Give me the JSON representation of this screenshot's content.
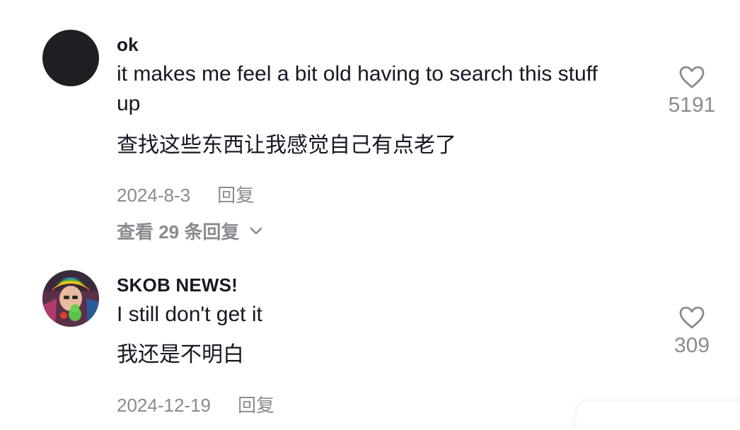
{
  "comments": [
    {
      "username": "ok",
      "text": "it makes me feel a bit old having to search this stuff up",
      "translation": "查找这些东西让我感觉自己有点老了",
      "date": "2024-8-3",
      "reply_label": "回复",
      "view_replies": "查看 29 条回复",
      "likes": "5191",
      "avatar": "dark-circle"
    },
    {
      "username": "SKOB NEWS!",
      "text": "I still don't get it",
      "translation": "我还是不明白",
      "date": "2024-12-19",
      "reply_label": "回复",
      "likes": "309",
      "avatar": "person-with-rainbow-hat"
    }
  ],
  "colors": {
    "primary_text": "#161823",
    "secondary_text": "#8a8b91",
    "icon_gray": "#8a8b91"
  }
}
